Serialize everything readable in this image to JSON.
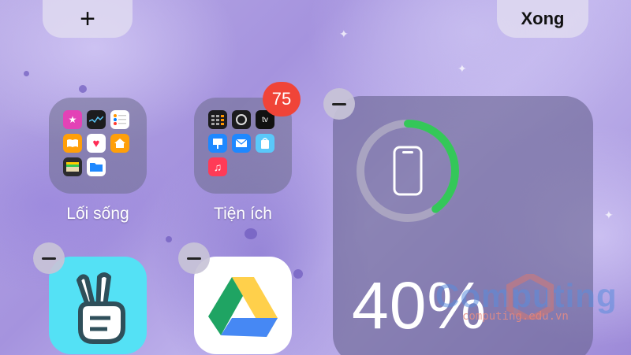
{
  "top_bar": {
    "add_label": "+",
    "done_label": "Xong"
  },
  "folders": [
    {
      "label": "Lối sống",
      "icons": [
        "star-icon",
        "stocks-icon",
        "reminders-icon",
        "books-icon",
        "health-icon",
        "home-icon",
        "wallet-icon",
        "files-icon"
      ]
    },
    {
      "label": "Tiện ích",
      "badge": "75",
      "icons": [
        "calculator-icon",
        "watch-icon",
        "apple-tv-icon",
        "keynote-icon",
        "mail-icon",
        "app-store-icon",
        "music-icon"
      ]
    }
  ],
  "apps": [
    {
      "name": "vlive-app"
    },
    {
      "name": "google-drive-app"
    }
  ],
  "battery_widget": {
    "percent_label": "40%",
    "level": 0.4,
    "ring_color": "#34c759",
    "device_icon": "iphone-icon"
  },
  "watermark": {
    "brand": "Computing",
    "url": "computing.edu.vn"
  },
  "colors": {
    "badge": "#f04438",
    "drive_green": "#1fa463",
    "drive_yellow": "#ffd04b",
    "drive_blue": "#4688f4",
    "vlive_bg": "#54e1f5"
  }
}
